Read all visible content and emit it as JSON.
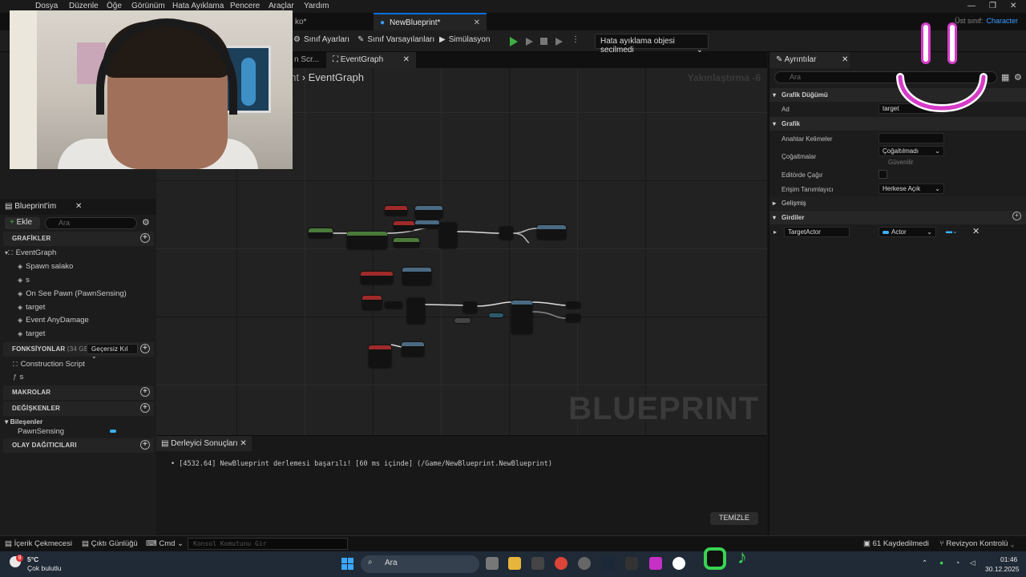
{
  "menubar": {
    "items": [
      "Dosya",
      "Düzenle",
      "Öğe",
      "Görünüm",
      "Hata Ayıklama",
      "Pencere",
      "Araçlar",
      "Yardım"
    ]
  },
  "doc_tabs": {
    "partial": "ko*",
    "active": "NewBlueprint*",
    "parent_class_label": "Üst sınıf:",
    "parent_class_value": "Character"
  },
  "toolbar": {
    "class_settings": "Sınıf Ayarları",
    "class_defaults": "Sınıf Varsayılanları",
    "simulation": "Simülasyon",
    "debug_object": "Hata ayıklama objesi seçilmedi"
  },
  "left_panel": {
    "tab": "Blueprint'im",
    "add_label": "Ekle",
    "search_placeholder": "Ara",
    "sections": {
      "graphs": "GRAFİKLER",
      "functions": "FONKSİYONLAR",
      "functions_note": "(34 GEÇERS",
      "override": "Geçersiz Kıl",
      "macros": "MAKROLAR",
      "variables": "DEĞİŞKENLER",
      "dispatchers": "OLAY DAĞITICILARI"
    },
    "graph_root": "EventGraph",
    "graph_items": [
      "Spawn salako",
      "s",
      "On See Pawn (PawnSensing)",
      "target",
      "Event AnyDamage",
      "target"
    ],
    "functions": [
      "Construction Script",
      "s"
    ],
    "components_label": "Bileşenler",
    "components": [
      "PawnSensing"
    ]
  },
  "graph": {
    "tabs": [
      "n Scr...",
      "EventGraph"
    ],
    "breadcrumb_parent": "rint",
    "breadcrumb_current": "EventGraph",
    "zoom": "Yakınlaştırma -6",
    "watermark": "BLUEPRINT"
  },
  "compiler": {
    "tab": "Derleyici Sonuçları",
    "message": "[4532.64] NewBlueprint derlemesi başarılı! [60 ms içinde] (/Game/NewBlueprint.NewBlueprint)",
    "clear_button": "TEMİZLE"
  },
  "details": {
    "tab": "Ayrıntılar",
    "search_placeholder": "Ara",
    "graph_node_header": "Grafik Düğümü",
    "name_label": "Ad",
    "name_value": "target",
    "graph_header": "Grafik",
    "keywords_label": "Anahtar Kelimeler",
    "replication_label": "Çoğaltmalar",
    "replication_value": "Çoğaltılmadı",
    "reliable_label": "Güvenilir",
    "call_in_editor_label": "Editörde Çağır",
    "access_label": "Erişim Tanımlayıcı",
    "access_value": "Herkese Açık",
    "advanced_header": "Gelişmiş",
    "inputs_header": "Girdiler",
    "input_name": "TargetActor",
    "input_type": "Actor"
  },
  "statusbar": {
    "content_drawer": "İçerik Çekmecesi",
    "output_log": "Çıktı Günlüğü",
    "cmd": "Cmd",
    "console_placeholder": "Konsol Komutunu Gir",
    "unsaved": "61 Kaydedilmedi",
    "revision": "Revizyon Kontrolü"
  },
  "taskbar": {
    "temperature": "5°C",
    "weather": "Çok bulutlu",
    "weather_badge": "9",
    "search": "Ara",
    "time": "01:46",
    "date": "30.12.2025"
  },
  "colors": {
    "accent": "#0070e0",
    "play": "#3cb043",
    "overlay_pink": "#d63bc9",
    "overlay_green": "#39d353"
  }
}
